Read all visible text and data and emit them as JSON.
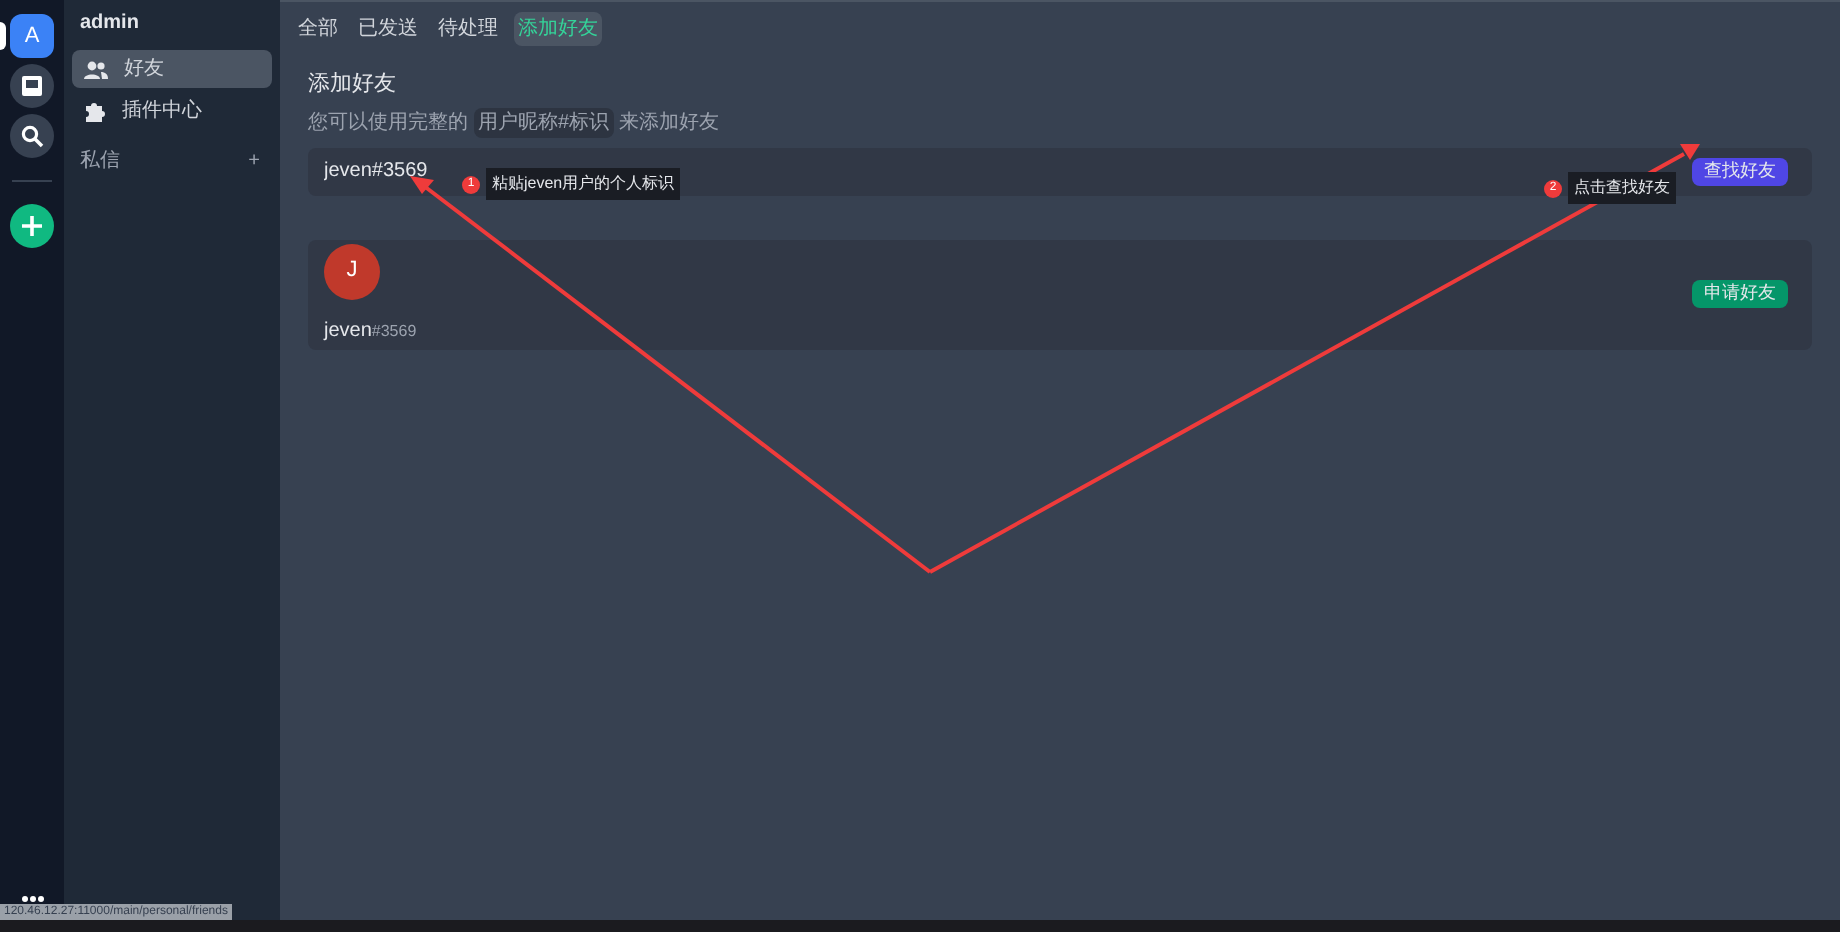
{
  "rail": [
    {
      "kind": "avatar",
      "label": "A",
      "selected": true
    },
    {
      "kind": "inbox",
      "selected": false
    },
    {
      "kind": "search",
      "selected": false
    },
    {
      "kind": "add"
    },
    {
      "kind": "more"
    }
  ],
  "sidebar": {
    "user": "admin",
    "items": [
      {
        "kind": "friends",
        "label": "好友",
        "selected": true
      },
      {
        "kind": "plugins",
        "label": "插件中心",
        "selected": false
      }
    ],
    "section": {
      "label": "私信",
      "action": "+"
    }
  },
  "tabs": [
    {
      "label": "全部",
      "selected": false
    },
    {
      "label": "已发送",
      "selected": false
    },
    {
      "label": "待处理",
      "selected": false
    },
    {
      "label": "添加好友",
      "selected": true
    }
  ],
  "add_friend": {
    "title": "添加好友",
    "hint_before": "您可以使用完整的",
    "hint_code": "用户昵称#标识",
    "hint_after": "来添加好友",
    "value": "jeven#3569",
    "button": "查找好友"
  },
  "result": {
    "avatar": "J",
    "name": "jeven",
    "tag": "#3569",
    "button": "申请好友"
  },
  "annotations": [
    {
      "number": "1",
      "text": "粘贴jeven用户的个人标识"
    },
    {
      "number": "2",
      "text": "点击查找好友"
    }
  ],
  "status_url": "120.46.12.27:11000/main/personal/friends"
}
